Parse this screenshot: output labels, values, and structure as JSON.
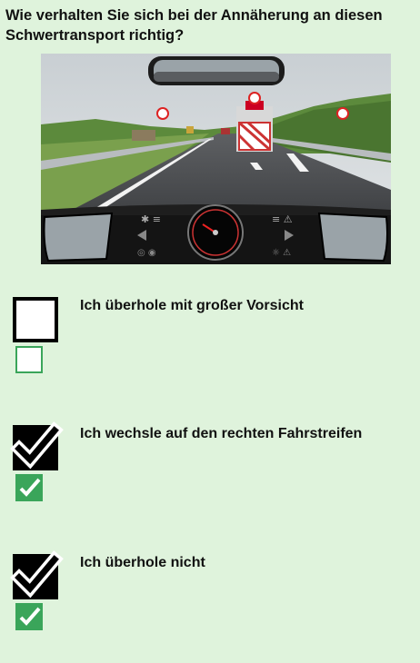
{
  "question": {
    "text": "Wie verhalten Sie sich bei der Annäherung an diesen Schwertransport richtig?"
  },
  "scene": {
    "description_icon": "road-scene-image"
  },
  "answers": [
    {
      "label": "Ich überhole mit großer Vorsicht",
      "checked": false
    },
    {
      "label": "Ich wechsle auf den rechten Fahrstreifen",
      "checked": true
    },
    {
      "label": "Ich überhole nicht",
      "checked": true
    }
  ],
  "colors": {
    "background": "#dff3dc",
    "check_green": "#3aa55a"
  }
}
